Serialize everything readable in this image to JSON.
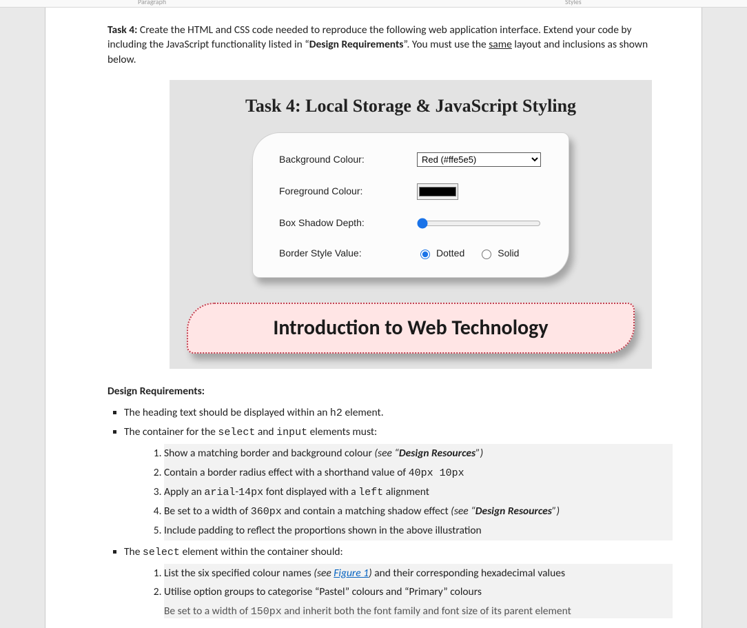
{
  "ribbon": {
    "paragraph": "Paragraph",
    "styles": "Styles"
  },
  "task": {
    "label": "Task 4:",
    "intro1": " Create the HTML and CSS code needed to reproduce the following web application interface. Extend your code by including the JavaScript functionality listed in “",
    "dr": "Design Requirements",
    "intro2": "”. You must use the ",
    "same": "same",
    "intro3": " layout and inclusions as shown below."
  },
  "embedded": {
    "title": "Task 4: Local Storage & JavaScript Styling",
    "labels": {
      "bg": "Background Colour:",
      "fg": "Foreground Colour:",
      "shadow": "Box Shadow Depth:",
      "border": "Border Style Value:"
    },
    "bgSelected": "Red (#ffe5e5)",
    "fgValue": "#000000",
    "radio": {
      "dotted": "Dotted",
      "solid": "Solid"
    },
    "banner": "Introduction to Web Technology"
  },
  "req": {
    "heading": "Design Requirements:",
    "b1a": "The heading text should be displayed within an ",
    "b1code": "h2",
    "b1b": " element.",
    "b2a": "The container for the ",
    "b2code1": "select",
    "b2mid": " and ",
    "b2code2": "input",
    "b2b": " elements must:",
    "c1a": "Show a matching border and background colour ",
    "c1i": "(see “",
    "c1b": "Design Resources",
    "c1c": "”)",
    "c2a": "Contain a border radius effect with a shorthand value of ",
    "c2code": "40px 10px",
    "c3a": "Apply an ",
    "c3code1": "arial",
    "c3dash": "-",
    "c3code2": "14px",
    "c3b": " font displayed with a ",
    "c3code3": "left",
    "c3c": " alignment",
    "c4a": "Be set to a width of ",
    "c4code": "360px",
    "c4b": " and contain a matching shadow effect ",
    "c4i": "(see “",
    "c4bold": "Design Resources",
    "c4c": "”)",
    "c5": "Include padding to reflect the proportions shown in the above illustration",
    "b3a": "The ",
    "b3code": "select",
    "b3b": " element within the container should:",
    "d1a": "List the six specified colour names ",
    "d1i1": "(see ",
    "d1link": "Figure 1",
    "d1i2": ")",
    "d1b": " and their corresponding hexadecimal values",
    "d2": "Utilise option groups to categorise “Pastel” colours and “Primary” colours",
    "d3a": "Be set to a width of ",
    "d3code": "150px",
    "d3b": " and inherit both the font family and font size of its parent element"
  }
}
